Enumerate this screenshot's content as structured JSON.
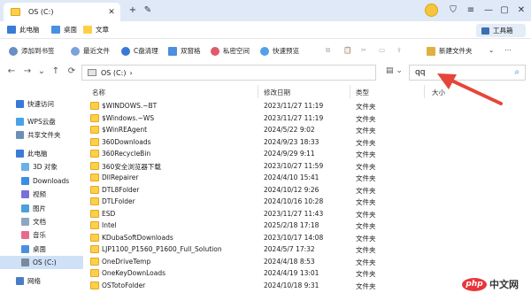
{
  "titlebar": {
    "tab_title": "OS (C:)",
    "tab_close": "✕",
    "new_tab": "+"
  },
  "quickbar": {
    "items": [
      {
        "label": "此电脑",
        "color": "#3a7bd5"
      },
      {
        "label": "桌面",
        "color": "#4a90e2"
      },
      {
        "label": "文章",
        "color": "#ffcf48"
      }
    ],
    "toolbox_label": "工具箱"
  },
  "commands": [
    {
      "label": "添加到书签",
      "color": "#6a8fc4",
      "disabled": false
    },
    {
      "label": "最近文件",
      "color": "#7aa3d9",
      "disabled": false
    },
    {
      "label": "C盘清理",
      "color": "#3a78d8",
      "disabled": false
    },
    {
      "label": "双窗格",
      "color": "#4b8fe0",
      "disabled": false
    },
    {
      "label": "私密空间",
      "color": "#e05a6a",
      "disabled": false
    },
    {
      "label": "快速预览",
      "color": "#53a0e8",
      "disabled": false
    },
    {
      "label": "新建文件夹",
      "color": "#e0b040",
      "disabled": false
    }
  ],
  "address": {
    "path": "OS (C:)"
  },
  "search": {
    "value": "qq"
  },
  "sidebar": {
    "items": [
      {
        "label": "快速访问",
        "color": "#3a78d8"
      },
      {
        "label": "WPS云盘",
        "color": "#4aa3e8"
      },
      {
        "label": "共享文件夹",
        "color": "#6b8fb8"
      },
      {
        "label": "此电脑",
        "color": "#3a7bd5"
      },
      {
        "label": "3D 对象",
        "color": "#6cb0e8"
      },
      {
        "label": "Downloads",
        "color": "#3a8ee6"
      },
      {
        "label": "视频",
        "color": "#7a6fd8"
      },
      {
        "label": "图片",
        "color": "#4aa0d8"
      },
      {
        "label": "文档",
        "color": "#8fa5c0"
      },
      {
        "label": "音乐",
        "color": "#e86a8a"
      },
      {
        "label": "桌面",
        "color": "#4a90e2"
      },
      {
        "label": "OS (C:)",
        "color": "#7a8a9a"
      },
      {
        "label": "网络",
        "color": "#4a7bc8"
      }
    ]
  },
  "columns": {
    "name": "名称",
    "date": "修改日期",
    "type": "类型",
    "size": "大小"
  },
  "files": [
    {
      "name": "$WINDOWS.~BT",
      "date": "2023/11/27 11:19",
      "type": "文件夹"
    },
    {
      "name": "$Windows.~WS",
      "date": "2023/11/27 11:19",
      "type": "文件夹"
    },
    {
      "name": "$WinREAgent",
      "date": "2024/5/22 9:02",
      "type": "文件夹"
    },
    {
      "name": "360Downloads",
      "date": "2024/9/23 18:33",
      "type": "文件夹"
    },
    {
      "name": "360RecycleBin",
      "date": "2024/9/29 9:11",
      "type": "文件夹"
    },
    {
      "name": "360安全浏览器下载",
      "date": "2023/10/27 11:59",
      "type": "文件夹"
    },
    {
      "name": "DllRepairer",
      "date": "2024/4/10 15:41",
      "type": "文件夹"
    },
    {
      "name": "DTL8Folder",
      "date": "2024/10/12 9:26",
      "type": "文件夹"
    },
    {
      "name": "DTLFolder",
      "date": "2024/10/16 10:28",
      "type": "文件夹"
    },
    {
      "name": "ESD",
      "date": "2023/11/27 11:43",
      "type": "文件夹"
    },
    {
      "name": "Intel",
      "date": "2025/2/18 17:18",
      "type": "文件夹"
    },
    {
      "name": "KDubaSoftDownloads",
      "date": "2023/10/17 14:08",
      "type": "文件夹"
    },
    {
      "name": "LJP1100_P1560_P1600_Full_Solution",
      "date": "2024/5/7 17:32",
      "type": "文件夹"
    },
    {
      "name": "OneDriveTemp",
      "date": "2024/4/18 8:53",
      "type": "文件夹"
    },
    {
      "name": "OneKeyDownLoads",
      "date": "2024/4/19 13:01",
      "type": "文件夹"
    },
    {
      "name": "OSTotoFolder",
      "date": "2024/10/18 9:31",
      "type": "文件夹"
    }
  ],
  "watermark": {
    "logo": "php",
    "text": "中文网"
  },
  "colors": {
    "accent": "#3b78d0",
    "arrow": "#e5463a",
    "titlebar": "#dfe9f7",
    "selected": "#cfe1f7"
  }
}
